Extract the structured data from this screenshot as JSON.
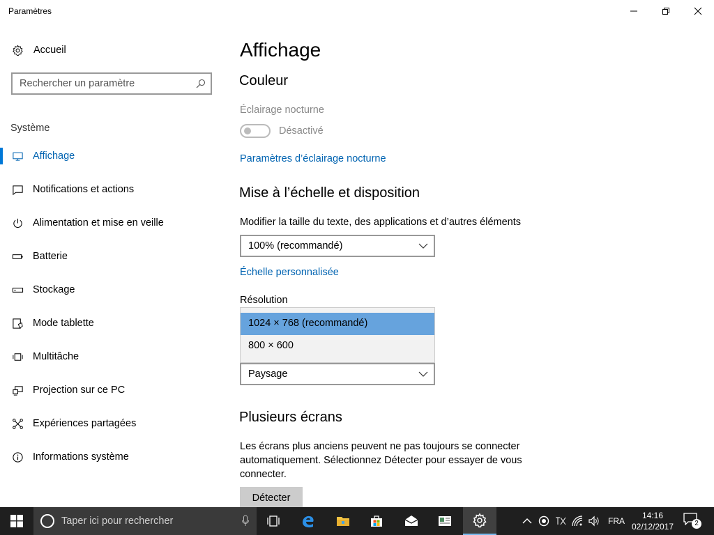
{
  "window": {
    "title": "Paramètres"
  },
  "sidebar": {
    "home_label": "Accueil",
    "search_placeholder": "Rechercher un paramètre",
    "section_label": "Système",
    "items": [
      {
        "label": "Affichage",
        "icon": "monitor-icon",
        "active": true
      },
      {
        "label": "Notifications et actions",
        "icon": "notification-icon"
      },
      {
        "label": "Alimentation et mise en veille",
        "icon": "power-icon"
      },
      {
        "label": "Batterie",
        "icon": "battery-icon"
      },
      {
        "label": "Stockage",
        "icon": "storage-icon"
      },
      {
        "label": "Mode tablette",
        "icon": "tablet-mode-icon"
      },
      {
        "label": "Multitâche",
        "icon": "multitask-icon"
      },
      {
        "label": "Projection sur ce PC",
        "icon": "projection-icon"
      },
      {
        "label": "Expériences partagées",
        "icon": "shared-experiences-icon"
      },
      {
        "label": "Informations système",
        "icon": "info-icon"
      }
    ]
  },
  "main": {
    "page_title": "Affichage",
    "color_heading": "Couleur",
    "night_light_label": "Éclairage nocturne",
    "night_light_state": "Désactivé",
    "night_light_settings_link": "Paramètres d’éclairage nocturne",
    "scale_heading": "Mise à l’échelle et disposition",
    "scale_description": "Modifier la taille du texte, des applications et d’autres éléments",
    "scale_value": "100% (recommandé)",
    "custom_scale_link": "Échelle personnalisée",
    "resolution_label": "Résolution",
    "resolution_options": [
      "1024 × 768 (recommandé)",
      "800 × 600"
    ],
    "orientation_value": "Paysage",
    "multi_heading": "Plusieurs écrans",
    "multi_desc_line1": "Les écrans plus anciens peuvent ne pas toujours se connecter",
    "multi_desc_line2": "automatiquement. Sélectionnez Détecter pour essayer de vous",
    "multi_desc_line3": "connecter.",
    "detect_button": "Détecter"
  },
  "taskbar": {
    "search_placeholder": "Taper ici pour rechercher",
    "language": "FRA",
    "time": "14:16",
    "date": "02/12/2017",
    "notification_count": "2"
  },
  "colors": {
    "accent": "#0078d7",
    "link": "#0063b1",
    "selection": "#66a3dd",
    "taskbar": "#1f1f1f"
  }
}
